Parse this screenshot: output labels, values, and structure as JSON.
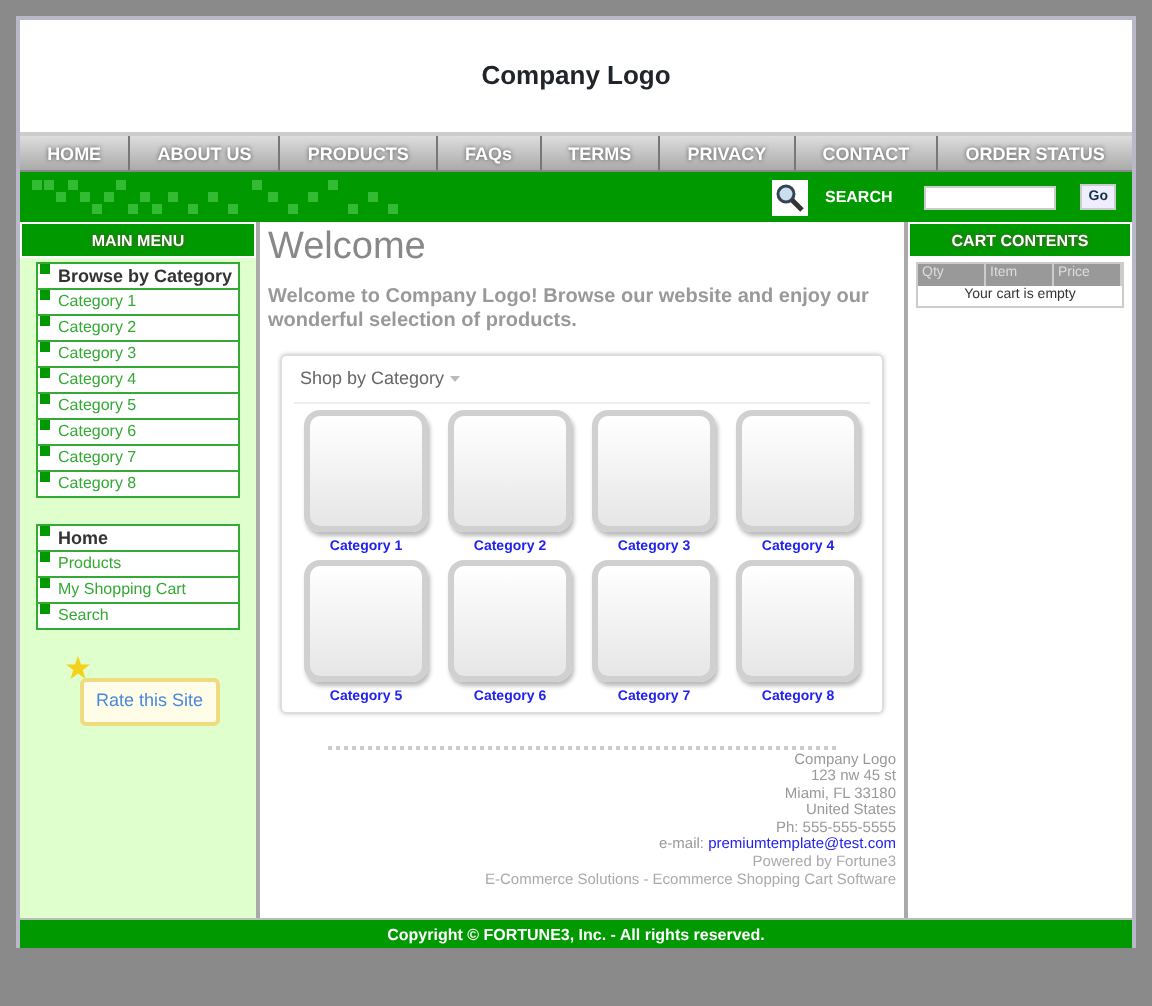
{
  "header": {
    "logo": "Company Logo"
  },
  "nav": [
    "HOME",
    "ABOUT US",
    "PRODUCTS",
    "FAQs",
    "TERMS",
    "PRIVACY",
    "CONTACT",
    "ORDER STATUS"
  ],
  "search": {
    "label": "SEARCH",
    "button": "Go"
  },
  "left": {
    "title": "MAIN MENU",
    "browse": {
      "heading": "Browse by Category",
      "items": [
        "Category 1",
        "Category 2",
        "Category 3",
        "Category 4",
        "Category 5",
        "Category 6",
        "Category 7",
        "Category 8"
      ]
    },
    "links": {
      "heading": "Home",
      "items": [
        "Products",
        "My Shopping Cart",
        "Search"
      ]
    },
    "rate_button": "Rate this Site"
  },
  "main": {
    "title": "Welcome",
    "intro": "Welcome to  Company Logo! Browse our website and enjoy our wonderful selection of products.",
    "shop": {
      "title": "Shop by Category",
      "categories": [
        "Category 1",
        "Category 2",
        "Category 3",
        "Category 4",
        "Category 5",
        "Category 6",
        "Category 7",
        "Category 8"
      ]
    },
    "address": [
      "Company Logo",
      "123 nw 45 st",
      "Miami, FL 33180",
      "United States",
      "Ph: 555-555-5555"
    ],
    "email_label": "e-mail:",
    "email": "premiumtemplate@test.com",
    "powered": [
      "Powered by Fortune3",
      "E-Commerce Solutions - Ecommerce Shopping Cart Software"
    ]
  },
  "cart": {
    "title": "CART CONTENTS",
    "columns": [
      "Qty",
      "Item",
      "Price"
    ],
    "empty": "Your cart is empty"
  },
  "copyright": "Copyright © FORTUNE3, Inc. - All rights reserved."
}
